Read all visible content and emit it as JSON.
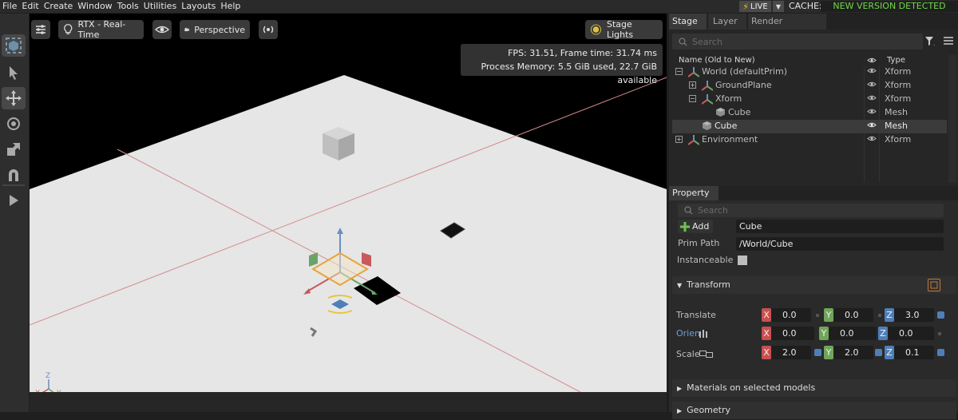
{
  "menubar": {
    "items": [
      "File",
      "Edit",
      "Create",
      "Window",
      "Tools",
      "Utilities",
      "Layouts",
      "Help"
    ],
    "live_label": "LIVE",
    "cache_label": "CACHE:",
    "new_version": "NEW VERSION DETECTED"
  },
  "viewport": {
    "renderer": "RTX - Real-Time",
    "camera": "Perspective",
    "lights": "Stage Lights",
    "fps_line": "FPS: 31.51, Frame time: 31.74 ms",
    "memory_line": "Process Memory: 5.5 GiB used, 22.7 GiB available",
    "axis_labels": {
      "x": "X",
      "y": "Y",
      "z": "Z"
    }
  },
  "stage": {
    "tabs": [
      "Stage",
      "Layer",
      "Render Settings"
    ],
    "search_placeholder": "Search",
    "col_name": "Name (Old to New)",
    "col_type": "Type",
    "rows": [
      {
        "name": "World (defaultPrim)",
        "type": "Xform"
      },
      {
        "name": "GroundPlane",
        "type": "Xform"
      },
      {
        "name": "Xform",
        "type": "Xform"
      },
      {
        "name": "Cube",
        "type": "Mesh"
      },
      {
        "name": "Cube",
        "type": "Mesh"
      },
      {
        "name": "Environment",
        "type": "Xform"
      }
    ]
  },
  "property": {
    "tab": "Property",
    "search_placeholder": "Search",
    "add_label": "Add",
    "prim_name": "Cube",
    "prim_path_label": "Prim Path",
    "prim_path": "/World/Cube",
    "instanceable_label": "Instanceable",
    "transform_label": "Transform",
    "translate_label": "Translate",
    "orient_label": "Orien",
    "scale_label": "Scale",
    "translate": [
      "0.0",
      "0.0",
      "3.0"
    ],
    "orient": [
      "0.0",
      "0.0",
      "0.0"
    ],
    "scale": [
      "2.0",
      "2.0",
      "0.1"
    ],
    "materials_label": "Materials on selected models",
    "geometry_label": "Geometry",
    "axis_letters": [
      "X",
      "Y",
      "Z"
    ]
  },
  "colors": {
    "accent_blue": "#4f7fb8",
    "axis_x": "#c8504f",
    "axis_y": "#6fa65a",
    "axis_z": "#4f7fb8",
    "new_version": "#6fd84a",
    "live_bolt": "#f3c623"
  }
}
